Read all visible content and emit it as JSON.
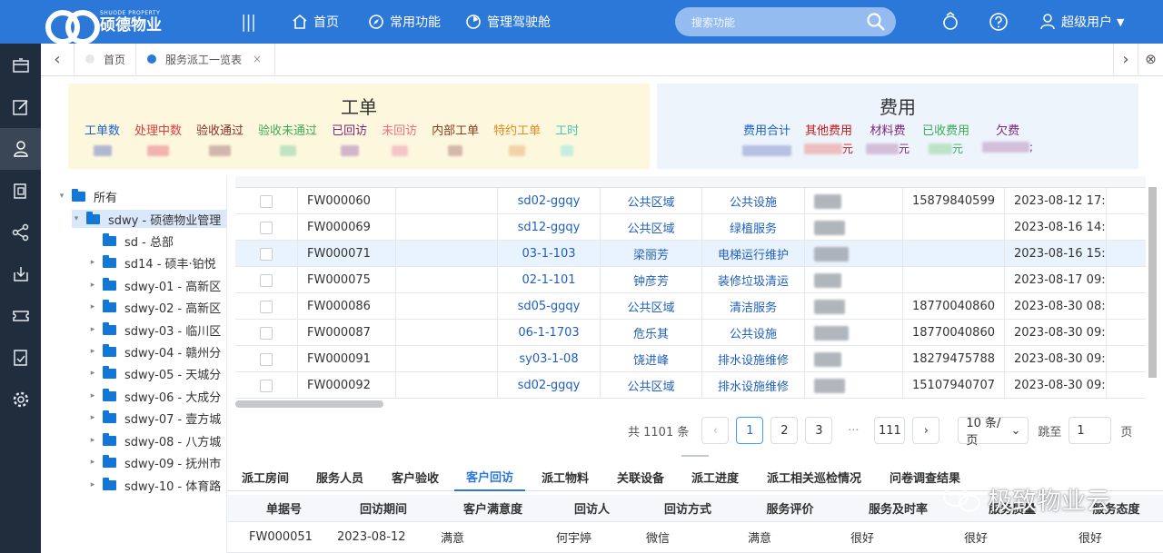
{
  "header": {
    "logo_small": "SHUODE PROPERTY",
    "logo_big": "硕德物业",
    "menu_toggle": "|||",
    "nav": [
      {
        "label": "首页",
        "icon": "home-icon"
      },
      {
        "label": "常用功能",
        "icon": "compass-icon"
      },
      {
        "label": "管理驾驶舱",
        "icon": "dashboard-icon"
      }
    ],
    "search_placeholder": "搜索功能",
    "user_name": "超级用户",
    "caret": "▼"
  },
  "tabs": {
    "prev": "‹",
    "next": "›",
    "close_all": "⊗",
    "items": [
      {
        "label": "首页",
        "dot_color": "#e8e8e8"
      },
      {
        "label": "服务派工一览表",
        "dot_color": "#2b78d8",
        "close": "×"
      }
    ]
  },
  "stats": {
    "workorder_title": "工单",
    "workorder_items": [
      {
        "label": "工单数",
        "color": "#1a62c9"
      },
      {
        "label": "处理中数",
        "color": "#e33b3b"
      },
      {
        "label": "验收通过",
        "color": "#8a2d25"
      },
      {
        "label": "验收未通过",
        "color": "#3dab55"
      },
      {
        "label": "已回访",
        "color": "#7a267a"
      },
      {
        "label": "未回访",
        "color": "#ef6e86"
      },
      {
        "label": "内部工单",
        "color": "#8b3a1d"
      },
      {
        "label": "特约工单",
        "color": "#e58a1c"
      },
      {
        "label": "工时",
        "color": "#42c7b0"
      }
    ],
    "cost_title": "费用",
    "cost_items": [
      {
        "label": "费用合计",
        "color": "#1a62c9",
        "suffix": ""
      },
      {
        "label": "其他费用",
        "color": "#c81818",
        "suffix": "元"
      },
      {
        "label": "材料费",
        "color": "#7a267a",
        "suffix": "元"
      },
      {
        "label": "已收费用",
        "color": "#3dab55",
        "suffix": "元"
      },
      {
        "label": "欠费",
        "color": "#7a267a",
        "suffix": ";"
      }
    ]
  },
  "tree": {
    "root": "所有",
    "nodes": [
      {
        "label": "sdwy - 硕德物业管理",
        "caret": "▾",
        "indent": 1
      },
      {
        "label": "sd - 总部",
        "caret": "",
        "indent": 2
      },
      {
        "label": "sd14 - 硕丰·铂悦",
        "caret": "▸",
        "indent": 2
      },
      {
        "label": "sdwy-01 - 高新区",
        "caret": "▸",
        "indent": 2
      },
      {
        "label": "sdwy-02 - 高新区",
        "caret": "▸",
        "indent": 2
      },
      {
        "label": "sdwy-03 - 临川区",
        "caret": "▸",
        "indent": 2
      },
      {
        "label": "sdwy-04 - 赣州分",
        "caret": "▸",
        "indent": 2
      },
      {
        "label": "sdwy-05 - 天城分",
        "caret": "▸",
        "indent": 2
      },
      {
        "label": "sdwy-06 - 大成分",
        "caret": "▸",
        "indent": 2
      },
      {
        "label": "sdwy-07 - 壹方城",
        "caret": "▸",
        "indent": 2
      },
      {
        "label": "sdwy-08 - 八方城",
        "caret": "▸",
        "indent": 2
      },
      {
        "label": "sdwy-09 - 抚州市",
        "caret": "▸",
        "indent": 2
      },
      {
        "label": "sdwy-10 - 体育路",
        "caret": "▸",
        "indent": 2
      }
    ]
  },
  "grid": {
    "rows": [
      {
        "id": "FW000060",
        "room": "sd02-ggqy",
        "customer": "公共区域",
        "service": "公共设施",
        "phone": "15879840599",
        "date": "2023-08-12 17:"
      },
      {
        "id": "FW000069",
        "room": "sd12-ggqy",
        "customer": "公共区域",
        "service": "绿植服务",
        "phone": "",
        "date": "2023-08-16 14:"
      },
      {
        "id": "FW000071",
        "room": "03-1-103",
        "customer": "梁丽芳",
        "service": "电梯运行维护",
        "phone": "",
        "date": "2023-08-16 15:"
      },
      {
        "id": "FW000075",
        "room": "02-1-101",
        "customer": "钟彦芳",
        "service": "装修垃圾清运",
        "phone": "",
        "date": "2023-08-17 09:"
      },
      {
        "id": "FW000086",
        "room": "sd05-ggqy",
        "customer": "公共区域",
        "service": "清洁服务",
        "phone": "18770040860",
        "date": "2023-08-30 08:"
      },
      {
        "id": "FW000087",
        "room": "06-1-1703",
        "customer": "危乐其",
        "service": "公共设施",
        "phone": "18770040860",
        "date": "2023-08-30 09:"
      },
      {
        "id": "FW000091",
        "room": "sy03-1-08",
        "customer": "饶进峰",
        "service": "排水设施维修",
        "phone": "18279475788",
        "date": "2023-08-30 09:"
      },
      {
        "id": "FW000092",
        "room": "sd02-ggqy",
        "customer": "公共区域",
        "service": "排水设施维修",
        "phone": "15107940707",
        "date": "2023-08-30 09:"
      }
    ]
  },
  "pagination": {
    "total": "共 1101 条",
    "prev": "‹",
    "pages": [
      "1",
      "2",
      "3",
      "···",
      "111"
    ],
    "next": "›",
    "page_size": "10 条/页",
    "page_size_caret": "⌄",
    "jump_label": "跳至",
    "jump_value": "1",
    "page_unit": "页"
  },
  "detail_tabs": [
    "派工房间",
    "服务人员",
    "客户验收",
    "客户回访",
    "派工物料",
    "关联设备",
    "派工进度",
    "派工相关巡检情况",
    "问卷调查结果"
  ],
  "subtable": {
    "headers": [
      "单据号",
      "回访期间",
      "客户满意度",
      "回访人",
      "回访方式",
      "服务评价",
      "服务及时率",
      "服务质量",
      "服务态度"
    ],
    "row": [
      "FW000051",
      "2023-08-12",
      "满意",
      "何宇婷",
      "微信",
      "满意",
      "很好",
      "很好",
      "很好"
    ]
  },
  "watermark": "极致物业云"
}
